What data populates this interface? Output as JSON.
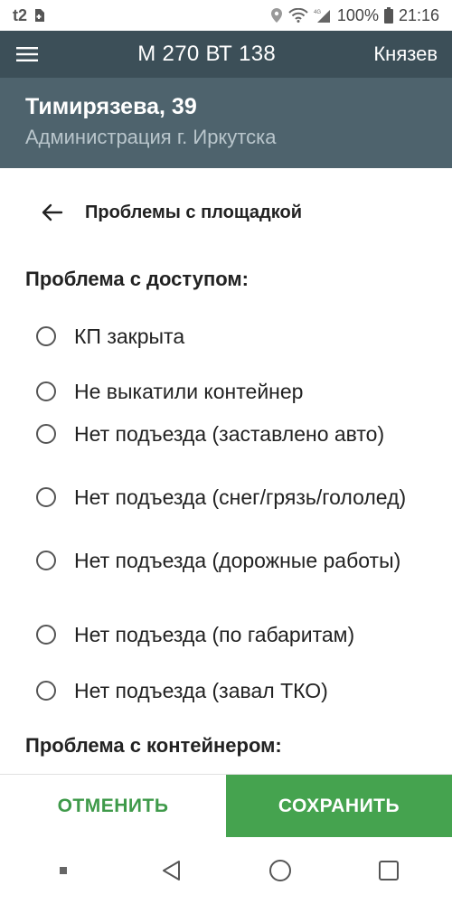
{
  "status_bar": {
    "carrier": "t2",
    "battery": "100%",
    "time": "21:16",
    "network": "4G",
    "icons": [
      "sim-icon",
      "location-icon",
      "wifi-icon",
      "signal-icon",
      "battery-icon"
    ]
  },
  "app_bar": {
    "title": "М 270 ВТ 138",
    "user": "Князев"
  },
  "address": {
    "title": "Тимирязева, 39",
    "subtitle": "Администрация г. Иркутска"
  },
  "section": {
    "title": "Проблемы с площадкой"
  },
  "groups": [
    {
      "title": "Проблема с доступом:",
      "options": [
        {
          "label": "КП закрыта",
          "selected": false
        },
        {
          "label": "Не выкатили контейнер",
          "selected": false
        },
        {
          "label": "Нет подъезда (заставлено авто)",
          "selected": false
        },
        {
          "label": "Нет подъезда (снег/грязь/гололед)",
          "selected": false
        },
        {
          "label": "Нет подъезда (дорожные работы)",
          "selected": false
        },
        {
          "label": "Нет подъезда (по габаритам)",
          "selected": false
        },
        {
          "label": "Нет подъезда (завал ТКО)",
          "selected": false
        }
      ]
    },
    {
      "title": "Проблема с контейнером:",
      "options": []
    }
  ],
  "buttons": {
    "cancel": "ОТМЕНИТЬ",
    "save": "СОХРАНИТЬ"
  },
  "colors": {
    "app_bar": "#3c4f58",
    "address_header": "#4e636d",
    "accent_green": "#45a34f"
  }
}
